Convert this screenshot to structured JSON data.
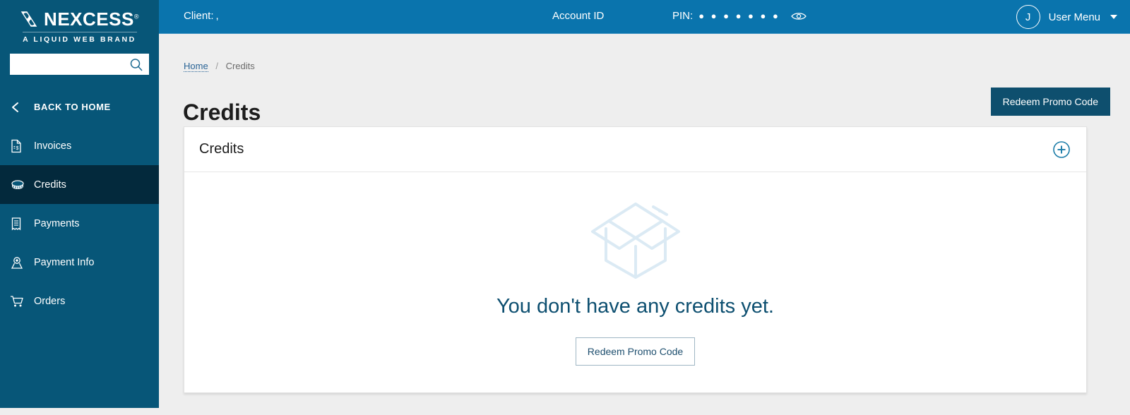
{
  "sidebar": {
    "brand": {
      "name": "NEXCESS",
      "trademark": "®",
      "tagline": "A LIQUID WEB BRAND"
    },
    "search": {
      "value": "",
      "placeholder": "",
      "icon": "search-icon"
    },
    "items": [
      {
        "label": "BACK TO HOME",
        "icon": "chevron-left-icon",
        "active": false
      },
      {
        "label": "Invoices",
        "icon": "invoice-document-icon",
        "active": false
      },
      {
        "label": "Credits",
        "icon": "coin-stack-icon",
        "active": true
      },
      {
        "label": "Payments",
        "icon": "receipt-icon",
        "active": false
      },
      {
        "label": "Payment Info",
        "icon": "payment-pin-icon",
        "active": false
      },
      {
        "label": "Orders",
        "icon": "shopping-cart-icon",
        "active": false
      }
    ]
  },
  "topbar": {
    "client_label": "Client:",
    "client_value": ",",
    "account_id_label": "Account ID",
    "account_id_value": "",
    "pin_label": "PIN:",
    "pin_masked": "● ● ● ● ● ● ●",
    "eye_icon": "eye-icon",
    "avatar_initial": "J",
    "user_menu_label": "User Menu"
  },
  "main": {
    "breadcrumb": {
      "home": "Home",
      "separator": "/",
      "current": "Credits"
    },
    "page_title": "Credits",
    "primary_button": "Redeem Promo Code",
    "card": {
      "title": "Credits",
      "add_icon": "plus-circle-icon",
      "empty_state": {
        "illustration": "open-box-icon",
        "message": "You don't have any credits yet.",
        "button": "Redeem Promo Code"
      }
    }
  },
  "colors": {
    "sidebar_bg": "#075678",
    "sidebar_active_bg": "#03293c",
    "topbar_bg": "#0a74ad",
    "page_bg": "#eeeeee",
    "primary_button_bg": "#0e4f6e",
    "accent": "#1b7ca8",
    "empty_text": "#0d4f70",
    "illustration": "#dbeaf4"
  }
}
